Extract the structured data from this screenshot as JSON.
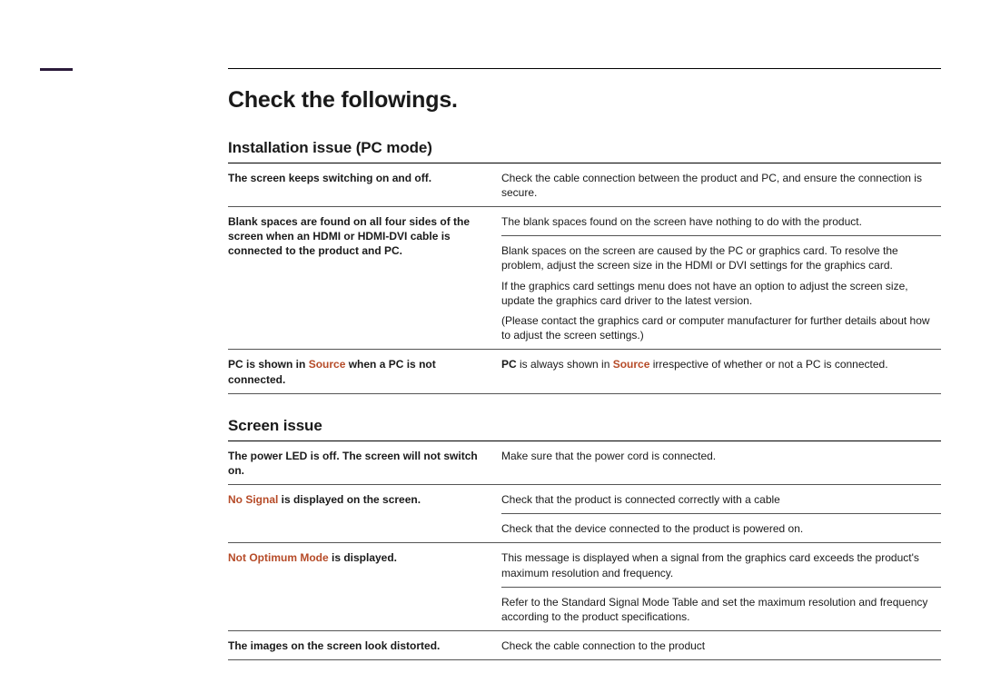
{
  "title": "Check the followings.",
  "section1": {
    "heading": "Installation issue (PC mode)",
    "r1l": "The screen keeps switching on and off.",
    "r1r": "Check the cable connection between the product and PC, and ensure the connection is secure.",
    "r2l": "Blank spaces are found on all four sides of the screen when an HDMI or HDMI-DVI cable is connected to the product and PC.",
    "r2r_a": "The blank spaces found on the screen have nothing to do with the product.",
    "r2r_b": "Blank spaces on the screen are caused by the PC or graphics card. To resolve the problem, adjust the screen size in the HDMI or DVI settings for the graphics card.",
    "r2r_c": "If the graphics card settings menu does not have an option to adjust the screen size, update the graphics card driver to the latest version.",
    "r2r_d": "(Please contact the graphics card or computer manufacturer for further details about how to adjust the screen settings.)",
    "r3l_a": "PC",
    "r3l_b": " is shown in ",
    "r3l_c": "Source",
    "r3l_d": " when a PC is not connected.",
    "r3r_a": "PC",
    "r3r_b": " is always shown in ",
    "r3r_c": "Source",
    "r3r_d": " irrespective of whether or not a PC is connected."
  },
  "section2": {
    "heading": "Screen issue",
    "r1l": "The power LED is off. The screen will not switch on.",
    "r1r": "Make sure that the power cord is connected.",
    "r2l_a": "No Signal",
    "r2l_b": " is displayed on the screen.",
    "r2r_a": "Check that the product is connected correctly with a cable",
    "r2r_b": "Check that the device connected to the product is powered on.",
    "r3l_a": "Not Optimum Mode",
    "r3l_b": " is displayed.",
    "r3r_a": "This message is displayed when a signal from the graphics card exceeds the product's maximum resolution and frequency.",
    "r3r_b": "Refer to the Standard Signal Mode Table and set the maximum resolution and frequency according to the product specifications.",
    "r4l": "The images on the screen look distorted.",
    "r4r": "Check the cable connection to the product"
  }
}
